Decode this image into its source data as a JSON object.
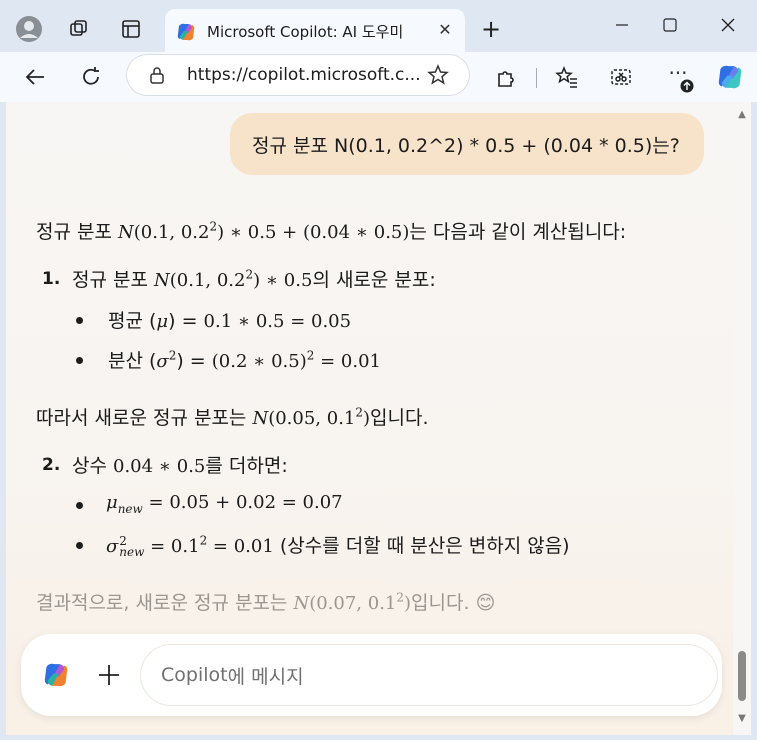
{
  "browser": {
    "tab_title": "Microsoft Copilot: AI 도우미",
    "url": "https://copilot.microsoft.c..."
  },
  "chat": {
    "user_message": "정규 분포 N(0.1, 0.2^2) * 0.5 + (0.04 * 0.5)는?",
    "response": {
      "intro_prefix": "정규 분포 ",
      "intro_math_a": "N",
      "intro_math_b": "(0.1, 0.2",
      "intro_math_sup": "2",
      "intro_math_c": ") ∗ 0.5 + (0.04 ∗ 0.5)",
      "intro_suffix": "는 다음과 같이 계산됩니다:",
      "step1": {
        "number": "1.",
        "prefix": "정규 분포 ",
        "math_a": "N",
        "math_b": "(0.1, 0.2",
        "math_sup": "2",
        "math_c": ") ∗ 0.5",
        "suffix": "의 새로운 분포:",
        "mean_label": "평균 (",
        "mean_symbol": "μ",
        "mean_close": ") = ",
        "mean_expr": "0.1 ∗ 0.5 = 0.05",
        "var_label": "분산 (",
        "var_symbol": "σ",
        "var_sup": "2",
        "var_close": ") = ",
        "var_expr_a": "(0.2 ∗ 0.5)",
        "var_expr_sup": "2",
        "var_expr_b": " = 0.01"
      },
      "middle_prefix": "따라서 새로운 정규 분포는 ",
      "middle_math_a": "N",
      "middle_math_b": "(0.05, 0.1",
      "middle_math_sup": "2",
      "middle_math_c": ")",
      "middle_suffix": "입니다.",
      "step2": {
        "number": "2.",
        "prefix": "상수 ",
        "math": "0.04 ∗ 0.5",
        "suffix": "를 더하면:",
        "mu_symbol": "μ",
        "mu_sub": "new",
        "mu_expr": " = 0.05 + 0.02 = 0.07",
        "sigma_symbol": "σ",
        "sigma_sup": "2",
        "sigma_sub": "new",
        "sigma_expr_a": " = 0.1",
        "sigma_expr_sup": "2",
        "sigma_expr_b": " = 0.01",
        "sigma_note": " (상수를 더할 때 분산은 변하지 않음)"
      },
      "conclusion_prefix": "결과적으로, 새로운 정규 분포는 ",
      "conclusion_math_a": "N",
      "conclusion_math_b": "(0.07, 0.1",
      "conclusion_math_sup": "2",
      "conclusion_math_c": ")",
      "conclusion_suffix": "입니다. 😊"
    }
  },
  "composer": {
    "brand": "Copilot",
    "placeholder_rest": "에 메시지"
  },
  "colors": {
    "user_bubble": "#f7e3ca",
    "page_bg": "#f8f6f4",
    "chrome_bg": "#dfe7f2"
  }
}
